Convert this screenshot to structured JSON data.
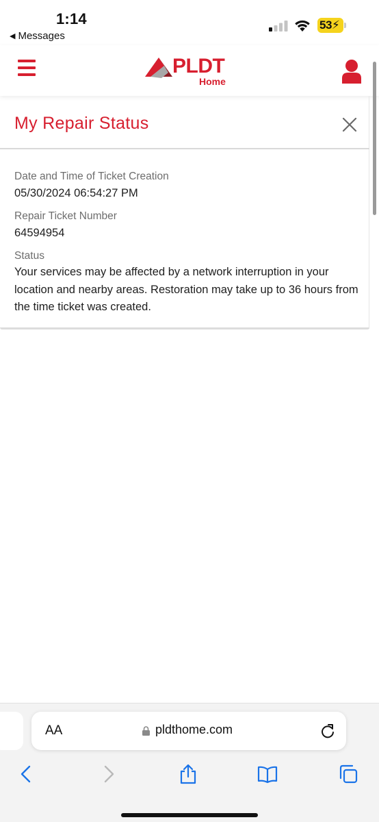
{
  "status_bar": {
    "time": "1:14",
    "back_app": "Messages",
    "battery": "53"
  },
  "header": {
    "brand": "PLDT",
    "brand_sub": "Home",
    "accent_color": "#d71f2f"
  },
  "repair": {
    "title": "My Repair Status",
    "date_label": "Date and Time of Ticket Creation",
    "date_value": "05/30/2024 06:54:27 PM",
    "ticket_label": "Repair Ticket Number",
    "ticket_value": "64594954",
    "status_label": "Status",
    "status_value": "Your services may be affected by a network interruption in your location and nearby areas. Restoration may take up to 36 hours from the time ticket was created."
  },
  "safari": {
    "text_size": "AA",
    "url": "pldthome.com"
  },
  "icons": [
    "menu-icon",
    "user-icon",
    "close-icon",
    "lock-icon",
    "reload-icon",
    "back-icon",
    "forward-icon",
    "share-icon",
    "bookmarks-icon",
    "tabs-icon"
  ]
}
